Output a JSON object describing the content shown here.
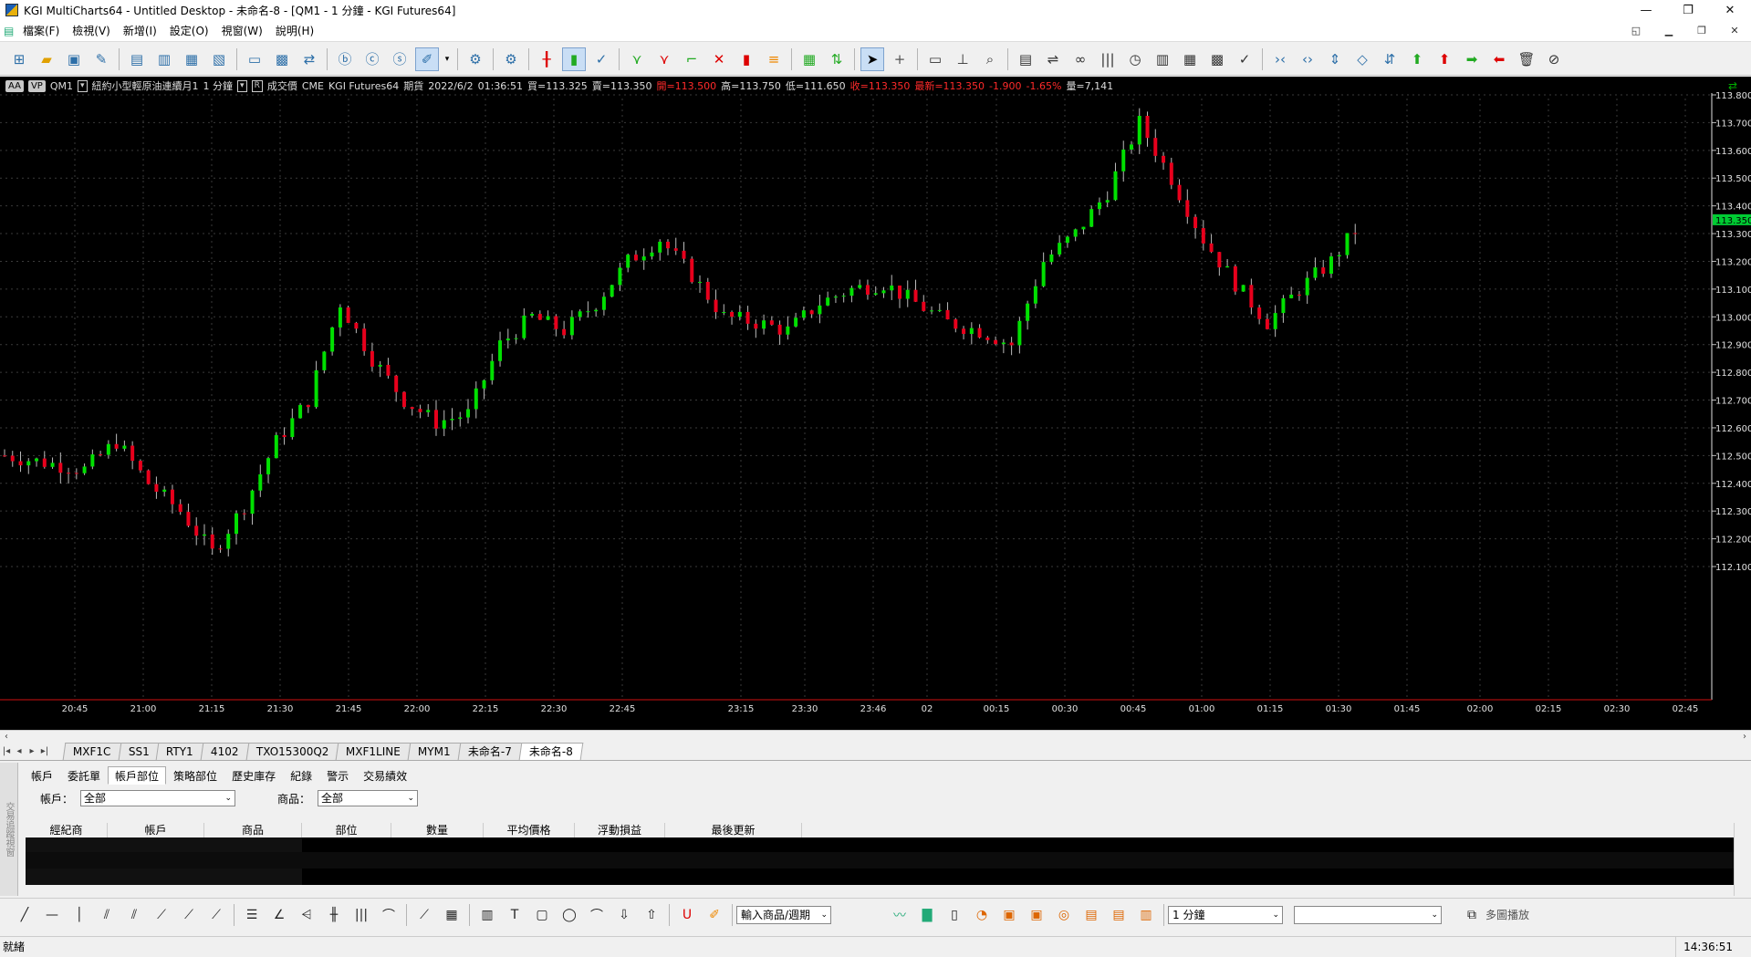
{
  "window": {
    "title": "KGI MultiCharts64 - Untitled Desktop - 未命名-8 - [QM1 - 1 分鐘 - KGI Futures64]",
    "minimize": "—",
    "maximize": "❐",
    "close": "✕"
  },
  "menu": {
    "items": [
      "▤",
      "檔案(F)",
      "檢視(V)",
      "新增(I)",
      "設定(O)",
      "視窗(W)",
      "說明(H)"
    ]
  },
  "toolbar1": {
    "icons": [
      "new-workspace",
      "open-folder",
      "save",
      "save-as",
      "separator",
      "new-chart",
      "new-scanner",
      "new-dom",
      "new-order-entry",
      "separator",
      "chart-window",
      "quote-window",
      "export",
      "separator",
      "add-symbol",
      "indicator",
      "strategy",
      "drawing-tool",
      "separator",
      "settings",
      "separator",
      "candle-style",
      "bar-style",
      "line-style",
      "separator",
      "zoom-in",
      "zoom-out",
      "pointer",
      "separator"
    ]
  },
  "infobar": {
    "aa": "AA",
    "vp": "VP",
    "symbol": "QM1",
    "name": "紐約小型輕原油連續月1",
    "interval": "1 分鐘",
    "r": "R",
    "type": "成交價",
    "exchange": "CME",
    "feed": "KGI Futures64",
    "kind": "期貨",
    "date": "2022/6/2",
    "time": "01:36:51",
    "bid": "買=113.325",
    "ask": "賣=113.350",
    "open": "開=113.500",
    "high": "高=113.750",
    "low": "低=111.650",
    "close": "收=113.350",
    "last": "最新=113.350",
    "change": "-1.900",
    "pct": "-1.65%",
    "volume": "量=7,141"
  },
  "chart_data": {
    "type": "candlestick",
    "title": "",
    "ylim": [
      112.05,
      113.85
    ],
    "yticks": [
      "113.800",
      "113.700",
      "113.600",
      "113.500",
      "113.400",
      "113.300",
      "113.200",
      "113.100",
      "113.000",
      "112.900",
      "112.800",
      "112.700",
      "112.600",
      "112.500",
      "112.400",
      "112.300",
      "112.200",
      "112.100"
    ],
    "xticks": [
      "20:45",
      "21:00",
      "21:15",
      "21:30",
      "21:45",
      "22:00",
      "22:15",
      "22:30",
      "22:45",
      "23:15",
      "23:30",
      "23:46",
      "02",
      "00:15",
      "00:30",
      "00:45",
      "01:00",
      "01:15",
      "01:30",
      "01:45",
      "02:00",
      "02:15",
      "02:30",
      "02:45"
    ],
    "last_price": "113.350",
    "last_label": "QM1",
    "up_color": "#00e000",
    "down_color": "#e8001c",
    "keypoints": [
      [
        0,
        112.5
      ],
      [
        10,
        112.45
      ],
      [
        14,
        112.55
      ],
      [
        18,
        112.4
      ],
      [
        22,
        112.3
      ],
      [
        26,
        112.15
      ],
      [
        30,
        112.32
      ],
      [
        34,
        112.55
      ],
      [
        38,
        112.7
      ],
      [
        42,
        113.05
      ],
      [
        46,
        112.85
      ],
      [
        50,
        112.7
      ],
      [
        54,
        112.62
      ],
      [
        58,
        112.65
      ],
      [
        62,
        112.9
      ],
      [
        66,
        113.0
      ],
      [
        70,
        112.95
      ],
      [
        74,
        113.05
      ],
      [
        78,
        113.2
      ],
      [
        82,
        113.28
      ],
      [
        86,
        113.15
      ],
      [
        90,
        113.0
      ],
      [
        94,
        112.98
      ],
      [
        98,
        112.95
      ],
      [
        102,
        113.05
      ],
      [
        106,
        113.1
      ],
      [
        110,
        113.12
      ],
      [
        114,
        113.05
      ],
      [
        118,
        112.98
      ],
      [
        122,
        112.95
      ],
      [
        126,
        112.9
      ],
      [
        130,
        113.2
      ],
      [
        134,
        113.3
      ],
      [
        138,
        113.45
      ],
      [
        142,
        113.7
      ],
      [
        146,
        113.5
      ],
      [
        150,
        113.28
      ],
      [
        154,
        113.12
      ],
      [
        158,
        112.98
      ],
      [
        162,
        113.1
      ],
      [
        166,
        113.2
      ],
      [
        170,
        113.35
      ]
    ]
  },
  "sheet_tabs": [
    "MXF1C",
    "SS1",
    "RTY1",
    "4102",
    "TXO15300Q2",
    "MXF1LINE",
    "MYM1",
    "未命名-7",
    "未命名-8"
  ],
  "sheet_nav": [
    "|◂",
    "◂",
    "▸",
    "▸|"
  ],
  "panel": {
    "side_label": "交易追蹤視窗",
    "tabs": [
      "帳戶",
      "委託單",
      "帳戶部位",
      "策略部位",
      "歷史庫存",
      "紀錄",
      "警示",
      "交易績效"
    ],
    "account_label": "帳戶：",
    "account_value": "全部",
    "product_label": "商品：",
    "product_value": "全部",
    "columns": [
      "經紀商",
      "帳戶",
      "商品",
      "部位",
      "數量",
      "平均價格",
      "浮動損益",
      "最後更新"
    ]
  },
  "toolbar2": {
    "symbol_combo": "輸入商品/週期",
    "interval_combo": "1 分鐘",
    "multiplay": "多圖播放"
  },
  "status": {
    "left": "就緒",
    "time": "14:36:51"
  }
}
